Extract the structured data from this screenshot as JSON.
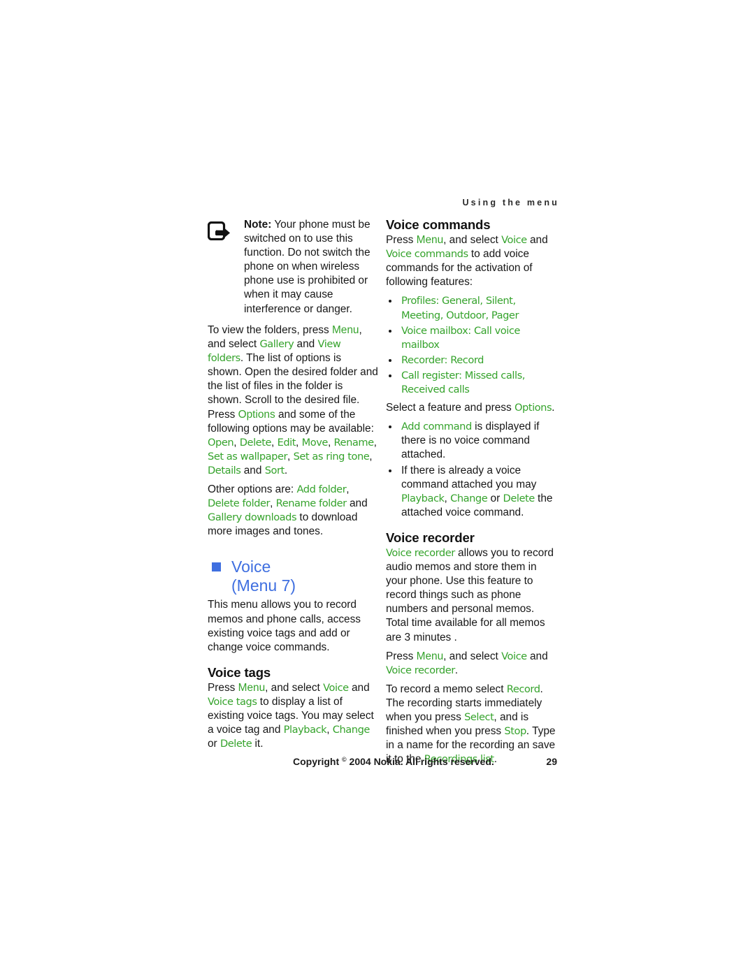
{
  "colors": {
    "green_term": "#35a32c",
    "blue_heading": "#3f6fe0",
    "body_text": "#171717",
    "background": "#ffffff"
  },
  "header": {
    "running_title": "Using the menu"
  },
  "left_column": {
    "note": {
      "icon": "note-arrow-icon",
      "label": "Note:",
      "text": " Your phone must be switched on to use this function. Do not switch the phone on when wireless phone use is prohibited or when it may cause interference or danger."
    },
    "gallery_paragraph": {
      "p1_a": "To view the folders, press ",
      "p1_menu": "Menu",
      "p1_b": ", and select ",
      "p1_gallery": "Gallery",
      "p1_c": " and ",
      "p1_viewfolders": "View folders",
      "p1_d": ". The list of options is shown. Open the desired folder and the list of files in the folder is shown. Scroll to the desired file. Press ",
      "p1_options": "Options",
      "p1_e": " and some of the following options may be available: ",
      "opt_open": "Open",
      "opt_delete": "Delete",
      "opt_edit": "Edit",
      "opt_move": "Move",
      "opt_rename": "Rename",
      "opt_wallpaper": "Set as wallpaper",
      "opt_ringtone": "Set as ring tone",
      "opt_details": "Details",
      "opt_and": " and ",
      "opt_sort": "Sort",
      "opt_period": "."
    },
    "other_options": {
      "a": "Other options are: ",
      "add_folder": "Add folder",
      "comma1": ", ",
      "delete_folder": "Delete folder",
      "comma2": ", ",
      "rename_folder": "Rename folder",
      "and": " and ",
      "gallery_downloads": "Gallery downloads",
      "tail": " to download more images and tones."
    },
    "chapter": {
      "title": "Voice",
      "menu_ref": "(Menu 7)",
      "bullet_square": "blue-square-bullet"
    },
    "chapter_intro": "This menu allows you to record memos and phone calls, access existing voice tags and add or change voice commands.",
    "voice_tags": {
      "heading": "Voice tags",
      "a": "Press ",
      "menu": "Menu",
      "b": ", and select ",
      "voice": "Voice",
      "c": " and ",
      "voice_tags_term": "Voice tags",
      "d": " to display a list of existing voice tags. You may select a voice tag and ",
      "playback": "Playback",
      "comma1": ", ",
      "change": "Change",
      "or": " or ",
      "delete": "Delete",
      "tail": " it."
    }
  },
  "right_column": {
    "voice_commands": {
      "heading": "Voice commands",
      "intro_a": "Press ",
      "intro_menu": "Menu",
      "intro_b": ", and select ",
      "intro_voice": "Voice",
      "intro_c": " and ",
      "intro_voice_commands": "Voice commands",
      "intro_d": " to add voice commands for the activation of following features:",
      "features": [
        {
          "parts": [
            "Profiles",
            "General",
            "Silent",
            "Meeting",
            "Outdoor",
            "Pager"
          ],
          "separators": [
            ": ",
            ", ",
            ", ",
            ", ",
            ", "
          ]
        },
        {
          "parts": [
            "Voice mailbox",
            "Call voice mailbox"
          ],
          "separators": [
            ": "
          ]
        },
        {
          "parts": [
            "Recorder",
            "Record"
          ],
          "separators": [
            ": "
          ]
        },
        {
          "parts": [
            "Call register",
            "Missed calls",
            "Received calls"
          ],
          "separators": [
            ": ",
            ", "
          ]
        }
      ],
      "select_line_a": "Select a feature and press ",
      "select_line_options": "Options",
      "select_line_b": ".",
      "notes": [
        {
          "green": "Add command",
          "rest": " is displayed if there is no voice command attached."
        }
      ],
      "note2_a": "If there is already a voice command attached you may ",
      "note2_playback": "Playback",
      "note2_c1": ", ",
      "note2_change": "Change",
      "note2_or": " or ",
      "note2_delete": "Delete",
      "note2_tail": " the attached voice command."
    },
    "voice_recorder": {
      "heading": "Voice recorder",
      "p1_term": "Voice recorder",
      "p1_rest": " allows you to record audio memos and store them in your phone. Use this feature to record things such as phone numbers and personal memos. Total time available for all memos are 3 minutes .",
      "p2_a": "Press ",
      "p2_menu": "Menu",
      "p2_b": ", and select ",
      "p2_voice": "Voice",
      "p2_c": " and ",
      "p2_voice_recorder": "Voice recorder",
      "p2_d": ".",
      "p3_a": "To record a memo select ",
      "p3_record": "Record",
      "p3_b": ". The recording starts immediately when you press ",
      "p3_select": "Select",
      "p3_c": ", and is finished when you press ",
      "p3_stop": "Stop",
      "p3_d": ". Type in a name for the recording an save it to the ",
      "p3_recordings_list": "Recordings list",
      "p3_e": "."
    }
  },
  "footer": {
    "copyright": "Copyright",
    "registered_mark": "©",
    "copyright_rest": "2004 Nokia. All rights reserved.",
    "page_number": "29"
  }
}
